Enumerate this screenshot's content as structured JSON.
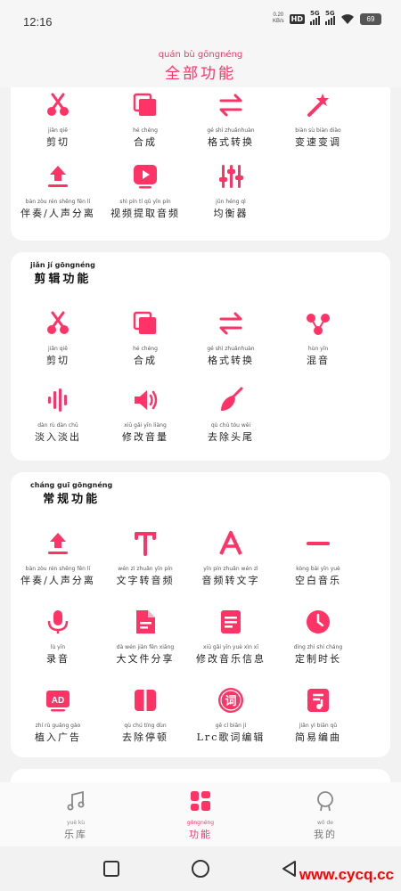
{
  "status_bar": {
    "time": "12:16",
    "net_speed_value": "0.20",
    "net_speed_unit": "KB/s",
    "hd_badge": "HD",
    "sim1_label": "5G",
    "sim2_label": "5G",
    "battery": "69"
  },
  "header": {
    "title": "全部功能",
    "title_pinyin": "quán bù gōngnéng"
  },
  "colors": {
    "accent": "#ff3366",
    "icon_inactive": "#888888"
  },
  "sections": [
    {
      "title": "",
      "title_pinyin": "",
      "items": [
        {
          "label": "剪切",
          "pinyin": "jiǎn qiē",
          "icon": "scissors-icon"
        },
        {
          "label": "合成",
          "pinyin": "hé chéng",
          "icon": "merge-icon"
        },
        {
          "label": "格式转换",
          "pinyin": "gé shì zhuǎnhuàn",
          "icon": "swap-icon"
        },
        {
          "label": "变速变调",
          "pinyin": "biàn sù biàn diào",
          "icon": "magic-wand-icon"
        },
        {
          "label": "伴奏/人声分离",
          "pinyin": "bàn zòu    rén shēng fēn lí",
          "icon": "upload-icon"
        },
        {
          "label": "视频提取音频",
          "pinyin": "shì pín tí qǔ yīn pín",
          "icon": "video-play-icon"
        },
        {
          "label": "均衡器",
          "pinyin": "jūn héng qì",
          "icon": "equalizer-icon"
        }
      ]
    },
    {
      "title": "剪辑功能",
      "title_pinyin": "jiǎn jí gōngnéng",
      "items": [
        {
          "label": "剪切",
          "pinyin": "jiǎn qiē",
          "icon": "scissors-icon"
        },
        {
          "label": "合成",
          "pinyin": "hé chéng",
          "icon": "merge-icon"
        },
        {
          "label": "格式转换",
          "pinyin": "gé shì zhuǎnhuàn",
          "icon": "swap-icon"
        },
        {
          "label": "混音",
          "pinyin": "hùn yīn",
          "icon": "mix-icon"
        },
        {
          "label": "淡入淡出",
          "pinyin": "dàn rù dàn chū",
          "icon": "fade-icon"
        },
        {
          "label": "修改音量",
          "pinyin": "xiū gǎi yīn liàng",
          "icon": "volume-icon"
        },
        {
          "label": "去除头尾",
          "pinyin": "qù chú tóu wěi",
          "icon": "trowel-icon"
        }
      ]
    },
    {
      "title": "常规功能",
      "title_pinyin": "cháng guī gōngnéng",
      "items": [
        {
          "label": "伴奏/人声分离",
          "pinyin": "bàn zòu    rén shēng fēn lí",
          "icon": "upload-icon"
        },
        {
          "label": "文字转音频",
          "pinyin": "wén zì zhuǎn yīn pín",
          "icon": "text-icon"
        },
        {
          "label": "音频转文字",
          "pinyin": "yīn pín zhuǎn wén zì",
          "icon": "letter-a-icon"
        },
        {
          "label": "空白音乐",
          "pinyin": "kòng bái yīn yuè",
          "icon": "minus-icon"
        },
        {
          "label": "录音",
          "pinyin": "lù yīn",
          "icon": "microphone-icon"
        },
        {
          "label": "大文件分享",
          "pinyin": "dà wén jiàn fēn xiǎng",
          "icon": "file-icon"
        },
        {
          "label": "修改音乐信息",
          "pinyin": "xiū gǎi yīn yuè xìn xī",
          "icon": "document-icon"
        },
        {
          "label": "定制时长",
          "pinyin": "dìng zhì shí cháng",
          "icon": "clock-icon"
        },
        {
          "label": "植入广告",
          "pinyin": "zhí rù guǎng gào",
          "icon": "ad-icon"
        },
        {
          "label": "去除停顿",
          "pinyin": "qù chú tíng dùn",
          "icon": "pause-icon"
        },
        {
          "label": "Lrc歌词编辑",
          "pinyin": "gē cí biān jí",
          "icon": "lyrics-icon"
        },
        {
          "label": "简易编曲",
          "pinyin": "jiǎn yì biān qǔ",
          "icon": "music-note-icon"
        }
      ]
    }
  ],
  "bottom_nav": [
    {
      "label": "乐库",
      "pinyin": "yuè kù",
      "icon": "music-library-icon",
      "active": false
    },
    {
      "label": "功能",
      "pinyin": "gōngnéng",
      "icon": "grid-icon",
      "active": true
    },
    {
      "label": "我的",
      "pinyin": "wǒ de",
      "icon": "profile-icon",
      "active": false
    }
  ],
  "watermark": "www.cycq.cc"
}
